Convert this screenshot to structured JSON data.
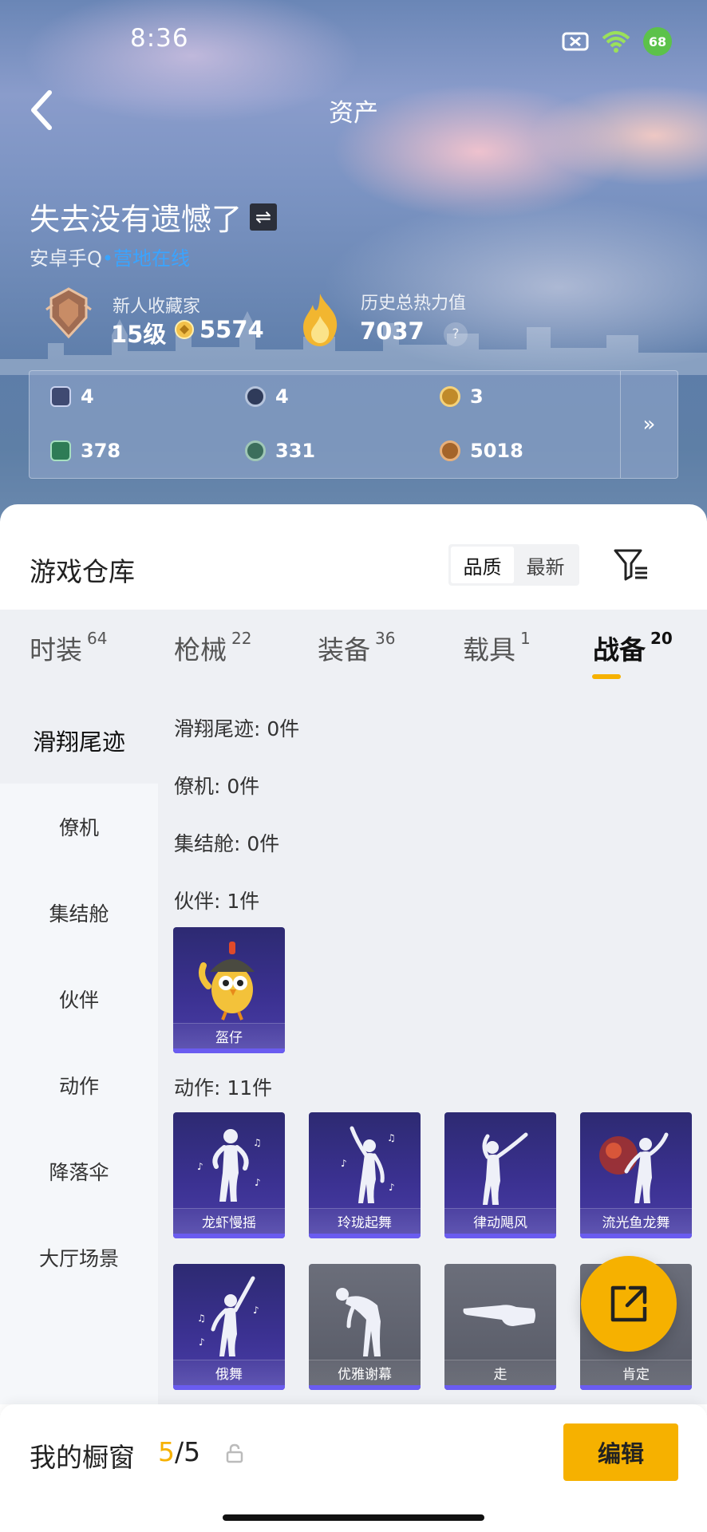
{
  "status": {
    "time": "8:36",
    "battery": "68"
  },
  "header": {
    "title": "资产"
  },
  "profile": {
    "name": "失去没有遗憾了",
    "platform": "安卓手Q",
    "dot": "•",
    "online": "营地在线",
    "rank_label": "新人收藏家",
    "level": "15级",
    "coins": "5574",
    "heat_label": "历史总热力值",
    "heat_value": "7037",
    "help": "?"
  },
  "resources": [
    {
      "value": "4",
      "color": "#3f4a72"
    },
    {
      "value": "4",
      "color": "#2f3b5a"
    },
    {
      "value": "3",
      "color": "#c08a2a"
    },
    {
      "value": "378",
      "color": "#2e7c56"
    },
    {
      "value": "331",
      "color": "#3c6e5c"
    },
    {
      "value": "5018",
      "color": "#a4642a"
    }
  ],
  "resources_more": "»",
  "warehouse": {
    "title": "游戏仓库",
    "sort_quality": "品质",
    "sort_latest": "最新"
  },
  "tabs": [
    {
      "label": "时装",
      "count": "64"
    },
    {
      "label": "枪械",
      "count": "22"
    },
    {
      "label": "装备",
      "count": "36"
    },
    {
      "label": "载具",
      "count": "1"
    },
    {
      "label": "战备",
      "count": "20"
    }
  ],
  "sidebar": [
    "滑翔尾迹",
    "僚机",
    "集结舱",
    "伙伴",
    "动作",
    "降落伞",
    "大厅场景"
  ],
  "sections": {
    "glide": "滑翔尾迹: 0件",
    "wingman": "僚机: 0件",
    "pod": "集结舱: 0件",
    "partner": "伙伴: 1件",
    "emote": "动作: 11件"
  },
  "partner_items": [
    {
      "name": "盔仔"
    }
  ],
  "emote_items": [
    {
      "name": "龙虾慢摇"
    },
    {
      "name": "玲珑起舞"
    },
    {
      "name": "律动飓风"
    },
    {
      "name": "流光鱼龙舞"
    },
    {
      "name": "俄舞"
    },
    {
      "name": "优雅谢幕"
    },
    {
      "name": "走"
    },
    {
      "name": "肯定"
    }
  ],
  "footer": {
    "title": "我的橱窗",
    "current": "5",
    "total": "/5",
    "edit": "编辑"
  },
  "colors": {
    "accent": "#f6b100",
    "online": "#3aa4ff",
    "card_purple": "#3b3191",
    "card_gray": "#575a66"
  }
}
